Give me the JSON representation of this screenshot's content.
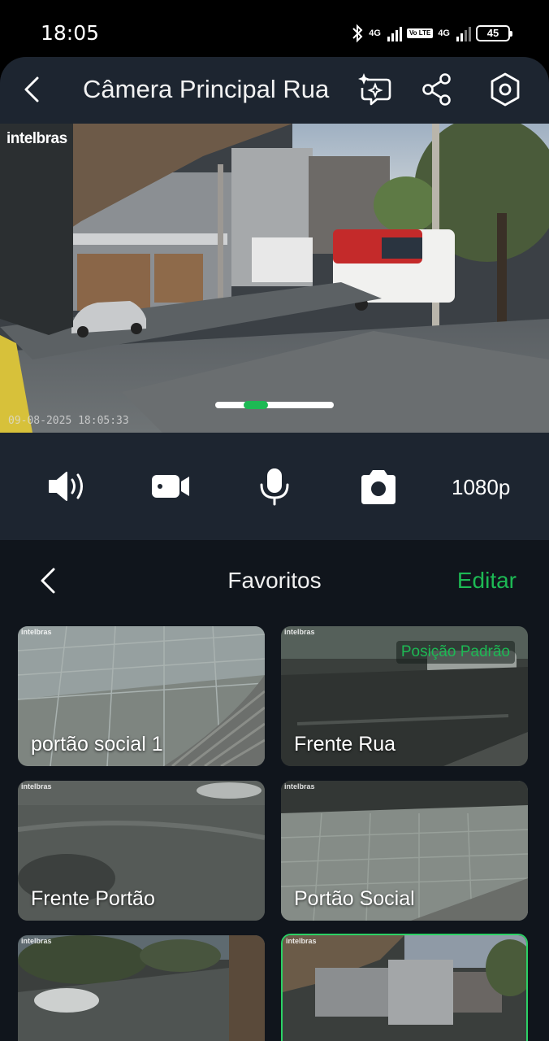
{
  "status_bar": {
    "time": "18:05",
    "net1": "4G",
    "net2": "4G",
    "volte": "Vo LTE",
    "battery": "45"
  },
  "header": {
    "title": "Câmera Principal Rua",
    "icons": [
      "back-icon",
      "ai-sparkle-message-icon",
      "share-icon",
      "settings-hexagon-icon"
    ]
  },
  "video": {
    "brand": "intelbras",
    "timestamp": "09-08-2025 18:05:33"
  },
  "controls": {
    "icons": [
      "speaker-icon",
      "record-video-icon",
      "microphone-icon",
      "camera-snapshot-icon"
    ],
    "resolution": "1080p"
  },
  "favorites": {
    "title": "Favoritos",
    "edit_label": "Editar",
    "tiles": [
      {
        "label": "portão social 1",
        "brand": "intelbras"
      },
      {
        "label": "Frente Rua",
        "brand": "intelbras",
        "badge": "Posição Padrão"
      },
      {
        "label": "Frente Portão",
        "brand": "intelbras"
      },
      {
        "label": "Portão Social",
        "brand": "intelbras"
      },
      {
        "label": "",
        "brand": "intelbras"
      },
      {
        "label": "",
        "brand": "intelbras"
      }
    ]
  },
  "colors": {
    "accent": "#1db954",
    "header_bg": "#1d2530",
    "panel_bg": "#10151c"
  }
}
